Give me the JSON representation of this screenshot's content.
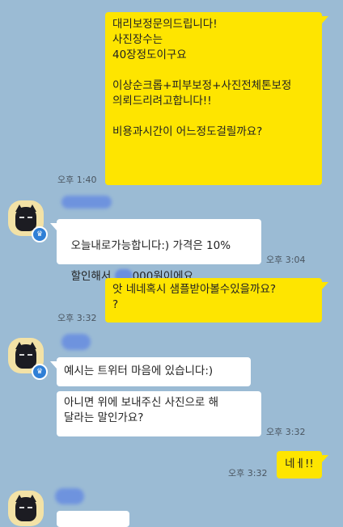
{
  "colors": {
    "background": "#9bbbd4",
    "my_bubble": "#fee500",
    "their_bubble": "#ffffff",
    "redaction": "#6a8fe0"
  },
  "messages": {
    "m1": {
      "text": "대리보정문의드립니다!\n사진장수는\n40장정도이구요\n\n이상순크롭+피부보정+사진전체톤보정\n의뢰드리려고합니다!!\n\n비용과시간이 어느정도걸릴까요?",
      "time": "오후 1:40"
    },
    "m2": {
      "text_a": "오늘내로가능합니다:) 가격은 10%",
      "text_b": "할인해서 ",
      "text_c": "000원이에요",
      "time": "오후 3:04"
    },
    "m3": {
      "text": "앗 네네혹시 샘플받아볼수있을까요?\n?",
      "time": "오후 3:32"
    },
    "m4": {
      "text": "예시는 트위터 마음에 있습니다:)"
    },
    "m5": {
      "text": "아니면 위에 보내주신 사진으로 해\n달라는 말인가요?",
      "time": "오후 3:32"
    },
    "m6": {
      "text": "네ㅔ!!",
      "time": "오후 3:32"
    }
  },
  "icons": {
    "avatar": "black-cat-avatar-icon",
    "badge": "crown-badge-icon"
  }
}
